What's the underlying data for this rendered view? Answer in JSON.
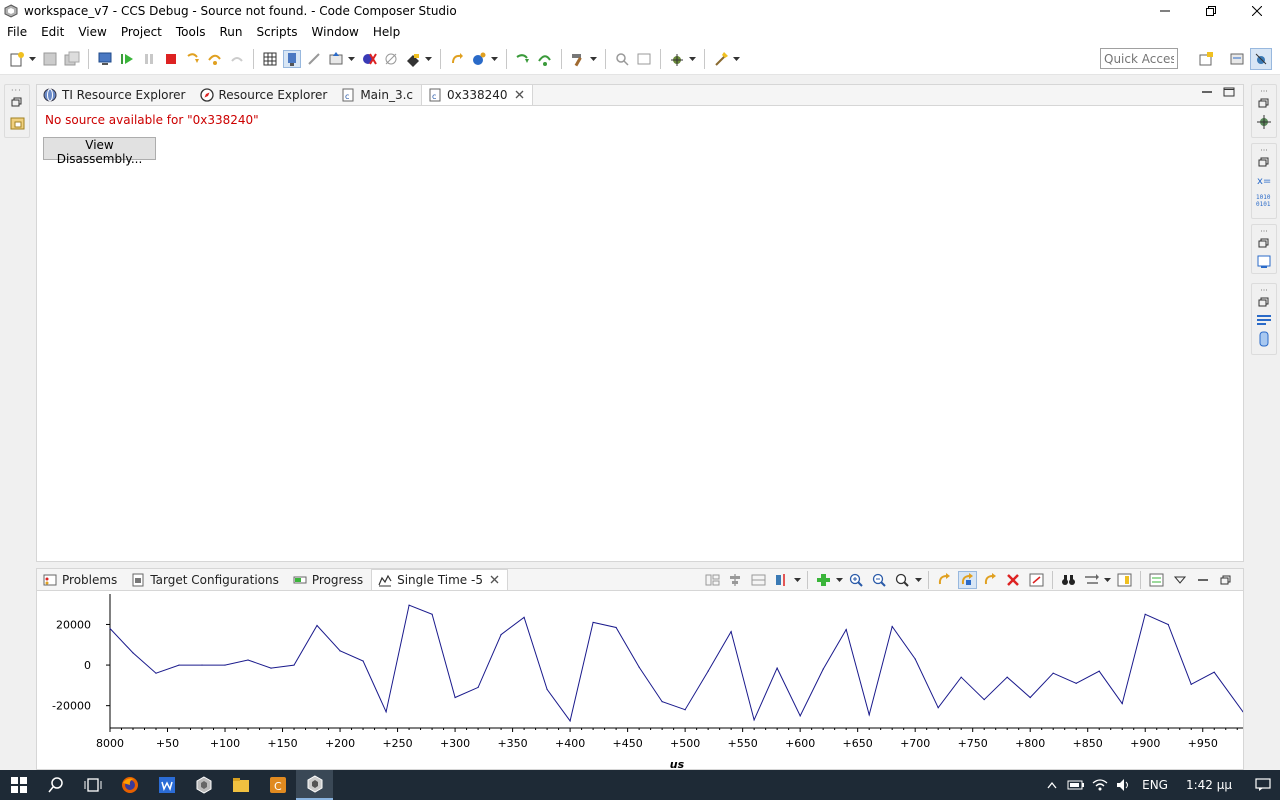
{
  "window": {
    "title": "workspace_v7 - CCS Debug - Source not found. - Code Composer Studio"
  },
  "menu": [
    "File",
    "Edit",
    "View",
    "Project",
    "Tools",
    "Run",
    "Scripts",
    "Window",
    "Help"
  ],
  "toolbar": {
    "quick_access": "Quick Access"
  },
  "editor": {
    "tabs": [
      {
        "label": "TI Resource Explorer",
        "icon": "globe-icon"
      },
      {
        "label": "Resource Explorer",
        "icon": "compass-icon"
      },
      {
        "label": "Main_3.c",
        "icon": "c-file-icon"
      },
      {
        "label": "0x338240",
        "icon": "c-file-icon"
      }
    ],
    "message": "No source available for \"0x338240\"",
    "button": "View Disassembly..."
  },
  "bottom": {
    "tabs": [
      {
        "label": "Problems",
        "icon": "problems-icon"
      },
      {
        "label": "Target Configurations",
        "icon": "target-config-icon"
      },
      {
        "label": "Progress",
        "icon": "progress-icon"
      },
      {
        "label": "Single Time -5",
        "icon": "graph-icon"
      }
    ]
  },
  "chart_data": {
    "type": "line",
    "xlabel": "us",
    "ylabel": "",
    "title": "",
    "xlim": [
      0,
      985
    ],
    "ylim": [
      -31000,
      35000
    ],
    "x_tick_labels": [
      "8000",
      "+50",
      "+100",
      "+150",
      "+200",
      "+250",
      "+300",
      "+350",
      "+400",
      "+450",
      "+500",
      "+550",
      "+600",
      "+650",
      "+700",
      "+750",
      "+800",
      "+850",
      "+900",
      "+950"
    ],
    "y_ticks": [
      20000,
      0,
      -20000
    ],
    "x": [
      0,
      20,
      40,
      60,
      80,
      100,
      120,
      140,
      160,
      180,
      200,
      220,
      240,
      260,
      280,
      300,
      320,
      340,
      360,
      380,
      400,
      420,
      440,
      460,
      480,
      500,
      520,
      540,
      560,
      580,
      600,
      620,
      640,
      660,
      680,
      700,
      720,
      740,
      760,
      780,
      800,
      820,
      840,
      860,
      880,
      900,
      920,
      940,
      960,
      985
    ],
    "values": [
      18000,
      6000,
      -4000,
      0,
      0,
      0,
      2500,
      -1500,
      0,
      19500,
      7000,
      2000,
      -23000,
      29500,
      25000,
      -16000,
      -11000,
      15000,
      23500,
      -12000,
      -27500,
      21000,
      18500,
      -1000,
      -18000,
      -22000,
      -3000,
      16500,
      -27000,
      -1500,
      -25000,
      -2000,
      17500,
      -24500,
      19000,
      3000,
      -21000,
      -6000,
      -17000,
      -6000,
      -16000,
      -4000,
      -9000,
      -3000,
      -19000,
      25000,
      20000,
      -9500,
      -3500,
      -23000
    ],
    "series": [
      {
        "color": "#1a1a8c"
      }
    ],
    "grid": false
  },
  "taskbar": {
    "language": "ENG",
    "time": "1:42 μμ"
  }
}
